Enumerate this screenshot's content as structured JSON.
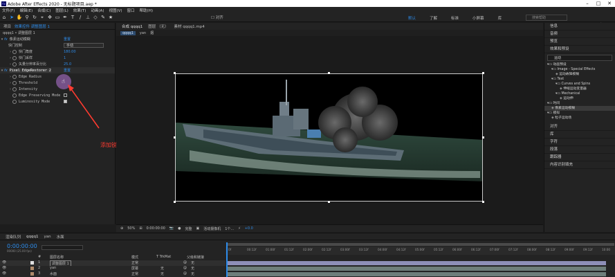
{
  "window": {
    "title": "Adobe After Effects 2020 - 无标题项目.aep *",
    "app_icon": "Ae"
  },
  "menu": [
    "文件(F)",
    "编辑(E)",
    "合成(C)",
    "图层(L)",
    "效果(T)",
    "动画(A)",
    "视图(V)",
    "窗口",
    "帮助(H)"
  ],
  "toolbar": {
    "snap_label": "对齐",
    "workspaces": [
      "默认",
      "了解",
      "标准",
      "小屏幕",
      "库"
    ],
    "search_placeholder": "搜索帮助"
  },
  "left_panel": {
    "tabs": [
      "项目",
      "效果控件 调整图层 1"
    ],
    "breadcrumb": "qqqq1 • 调整图层 1",
    "effect1": {
      "name": "像素运动模糊",
      "reset": "重置",
      "props": [
        {
          "label": "快门控制",
          "value": "手动",
          "type": "select"
        },
        {
          "label": "快门角度",
          "value": "180.00"
        },
        {
          "label": "快门采样",
          "value": "1"
        },
        {
          "label": "矢量分辨率百分比",
          "value": "25.0"
        }
      ]
    },
    "effect2": {
      "name": "Pixel EdgeRestorer 2",
      "reset": "重置",
      "props": [
        {
          "label": "Edge Radius",
          "value": ""
        },
        {
          "label": "Threshold",
          "value": ""
        },
        {
          "label": "Intensity",
          "value": ""
        },
        {
          "label": "Edge Preserving Mode",
          "checked": false
        },
        {
          "label": "Luminosity Mode",
          "checked": true
        }
      ]
    }
  },
  "annotation": "添加锐化",
  "viewer": {
    "tabs": [
      "合成 qqqq1",
      "图层 （无）",
      "素材 qqqq1.mp4"
    ],
    "sub": [
      "qqqq1",
      "yan",
      "烟"
    ],
    "controls": {
      "zoom": "50%",
      "timecode": "0:00:00:00",
      "resolution": "完整",
      "camera": "活动摄像机",
      "views": "1个...",
      "exposure": "+0.0"
    }
  },
  "right_panel": {
    "items": [
      "信息",
      "音频",
      "预览",
      "效果和预设"
    ],
    "search_value": "运动",
    "tree": [
      {
        "indent": 0,
        "label": "动画预设",
        "type": "folder"
      },
      {
        "indent": 1,
        "label": "Image - Special Effects",
        "type": "folder"
      },
      {
        "indent": 2,
        "label": "运动故障模糊",
        "type": "preset"
      },
      {
        "indent": 1,
        "label": "Text",
        "type": "folder"
      },
      {
        "indent": 2,
        "label": "Curves and Spins",
        "type": "folder"
      },
      {
        "indent": 3,
        "label": "伸缩运动变量器",
        "type": "preset"
      },
      {
        "indent": 2,
        "label": "Mechanical",
        "type": "folder"
      },
      {
        "indent": 3,
        "label": "运动伸",
        "type": "preset"
      },
      {
        "indent": 0,
        "label": "时间",
        "type": "folder"
      },
      {
        "indent": 1,
        "label": "像素运动模糊",
        "type": "effect",
        "selected": true
      },
      {
        "indent": 0,
        "label": "模拟",
        "type": "folder"
      },
      {
        "indent": 1,
        "label": "粒子运动场",
        "type": "effect"
      }
    ],
    "bottom_items": [
      "对齐",
      "库",
      "字符",
      "段落",
      "跟踪器",
      "内容识别填充"
    ]
  },
  "timeline": {
    "tabs": [
      "渲染队列",
      "qqqq1",
      "yan",
      "水面"
    ],
    "timecode": "0:00:00:00",
    "frames": "00000 (25.00 fps)",
    "headers": {
      "num": "#",
      "name": "图层名称",
      "mode": "模式",
      "trkmat": "T TrkMat",
      "parent": "父级和链接"
    },
    "layers": [
      {
        "num": "1",
        "name": "调整图层 1",
        "mode": "正常",
        "trkmat": "",
        "parent": "无",
        "color": "#e0e0e0"
      },
      {
        "num": "2",
        "name": "yan",
        "mode": "屏幕",
        "trkmat": "无",
        "parent": "无",
        "color": "#b08a6a"
      },
      {
        "num": "3",
        "name": "水面",
        "mode": "正常",
        "trkmat": "无",
        "parent": "无",
        "color": "#b08a6a"
      }
    ],
    "ruler_ticks": [
      "0f",
      "00:12f",
      "01:00f",
      "01:12f",
      "02:00f",
      "02:12f",
      "03:00f",
      "03:12f",
      "04:00f",
      "04:12f",
      "05:00f",
      "05:12f",
      "06:00f",
      "06:12f",
      "07:00f",
      "07:12f",
      "08:00f",
      "08:12f",
      "09:00f",
      "09:12f",
      "10:00"
    ]
  }
}
